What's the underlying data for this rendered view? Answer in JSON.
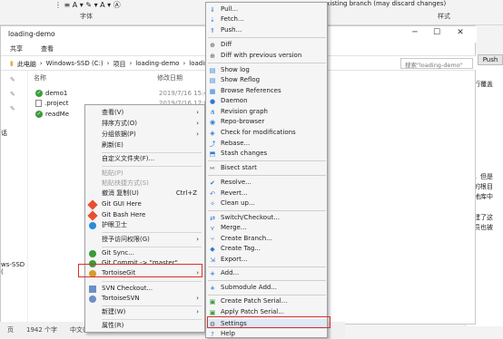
{
  "word": {
    "font_group": "字体",
    "style_group": "样式",
    "warning": "existing branch (may discard changes)",
    "toolbar": "⋮  ≡  A  ▾  ✎  ▾  A  ▾  Ⓐ",
    "doc_lines": [
      "强行覆盖",
      "中，但是",
      "库的根目",
      "本地库中",
      "创建了这",
      "成员也被"
    ]
  },
  "explorer": {
    "title": "loading-demo",
    "tabs": [
      "共享",
      "查看"
    ],
    "breadcrumb": [
      "此电脑",
      "Windows-SSD (C:)",
      "项目",
      "loading-demo",
      "loading-d"
    ],
    "search_placeholder": "搜索\"loading-demo\"",
    "nav_labels": [
      "话",
      "ws-SSD ("
    ],
    "columns": [
      "名称",
      "修改日期"
    ],
    "files": [
      {
        "name": "demo1",
        "date": "2019/7/16 15:48",
        "icon": "git-ok-folder-icon"
      },
      {
        "name": ".project",
        "date": "2019/7/16 17:05",
        "icon": "file-icon"
      },
      {
        "name": "readMe",
        "date": "",
        "icon": "git-ok-file-icon"
      }
    ],
    "status": [
      "1942 个字",
      "中文(中国)"
    ],
    "status_page": "页"
  },
  "push_label": "Push",
  "context_menu": {
    "items": [
      {
        "label": "查看(V)",
        "arrow": true
      },
      {
        "label": "排序方式(O)",
        "arrow": true
      },
      {
        "label": "分组依据(P)",
        "arrow": true
      },
      {
        "label": "刷新(E)"
      },
      {
        "label": "自定义文件夹(F)..."
      },
      {
        "label": "粘贴(P)",
        "disabled": true
      },
      {
        "label": "粘贴快捷方式(S)",
        "disabled": true
      },
      {
        "label": "撤消 复制(U)",
        "shortcut": "Ctrl+Z"
      },
      {
        "label": "Git GUI Here"
      },
      {
        "label": "Git Bash Here"
      },
      {
        "label": "护眼卫士"
      },
      {
        "label": "授予访问权限(G)",
        "arrow": true
      },
      {
        "label": "Git Sync..."
      },
      {
        "label": "Git Commit -> \"master\"..."
      },
      {
        "label": "TortoiseGit",
        "arrow": true
      },
      {
        "label": "SVN Checkout..."
      },
      {
        "label": "TortoiseSVN",
        "arrow": true
      },
      {
        "label": "新建(W)",
        "arrow": true
      },
      {
        "label": "属性(R)"
      }
    ]
  },
  "tortoise_menu": {
    "items": [
      {
        "label": "Pull...",
        "icon": "pull-icon"
      },
      {
        "label": "Fetch...",
        "icon": "fetch-icon"
      },
      {
        "label": "Push...",
        "icon": "push-icon"
      },
      {
        "label": "Diff",
        "icon": "diff-icon"
      },
      {
        "label": "Diff with previous version",
        "icon": "diff-previous-icon"
      },
      {
        "label": "Show log",
        "icon": "log-icon"
      },
      {
        "label": "Show Reflog",
        "icon": "reflog-icon"
      },
      {
        "label": "Browse References",
        "icon": "references-icon"
      },
      {
        "label": "Daemon",
        "icon": "daemon-icon"
      },
      {
        "label": "Revision graph",
        "icon": "revision-graph-icon"
      },
      {
        "label": "Repo-browser",
        "icon": "repo-browser-icon"
      },
      {
        "label": "Check for modifications",
        "icon": "check-modifications-icon"
      },
      {
        "label": "Rebase...",
        "icon": "rebase-icon"
      },
      {
        "label": "Stash changes",
        "icon": "stash-icon"
      },
      {
        "label": "Bisect start",
        "icon": "bisect-icon"
      },
      {
        "label": "Resolve...",
        "icon": "resolve-icon"
      },
      {
        "label": "Revert...",
        "icon": "revert-icon"
      },
      {
        "label": "Clean up...",
        "icon": "cleanup-icon"
      },
      {
        "label": "Switch/Checkout...",
        "icon": "switch-icon"
      },
      {
        "label": "Merge...",
        "icon": "merge-icon"
      },
      {
        "label": "Create Branch...",
        "icon": "branch-icon"
      },
      {
        "label": "Create Tag...",
        "icon": "tag-icon"
      },
      {
        "label": "Export...",
        "icon": "export-icon"
      },
      {
        "label": "Add...",
        "icon": "add-icon"
      },
      {
        "label": "Submodule Add...",
        "icon": "submodule-icon"
      },
      {
        "label": "Create Patch Serial...",
        "icon": "patch-icon"
      },
      {
        "label": "Apply Patch Serial...",
        "icon": "apply-patch-icon"
      },
      {
        "label": "Settings",
        "icon": "settings-icon"
      },
      {
        "label": "Help",
        "icon": "help-icon"
      }
    ]
  },
  "colors": {
    "highlight": "#d9302c",
    "selection": "#dfe9f5"
  }
}
